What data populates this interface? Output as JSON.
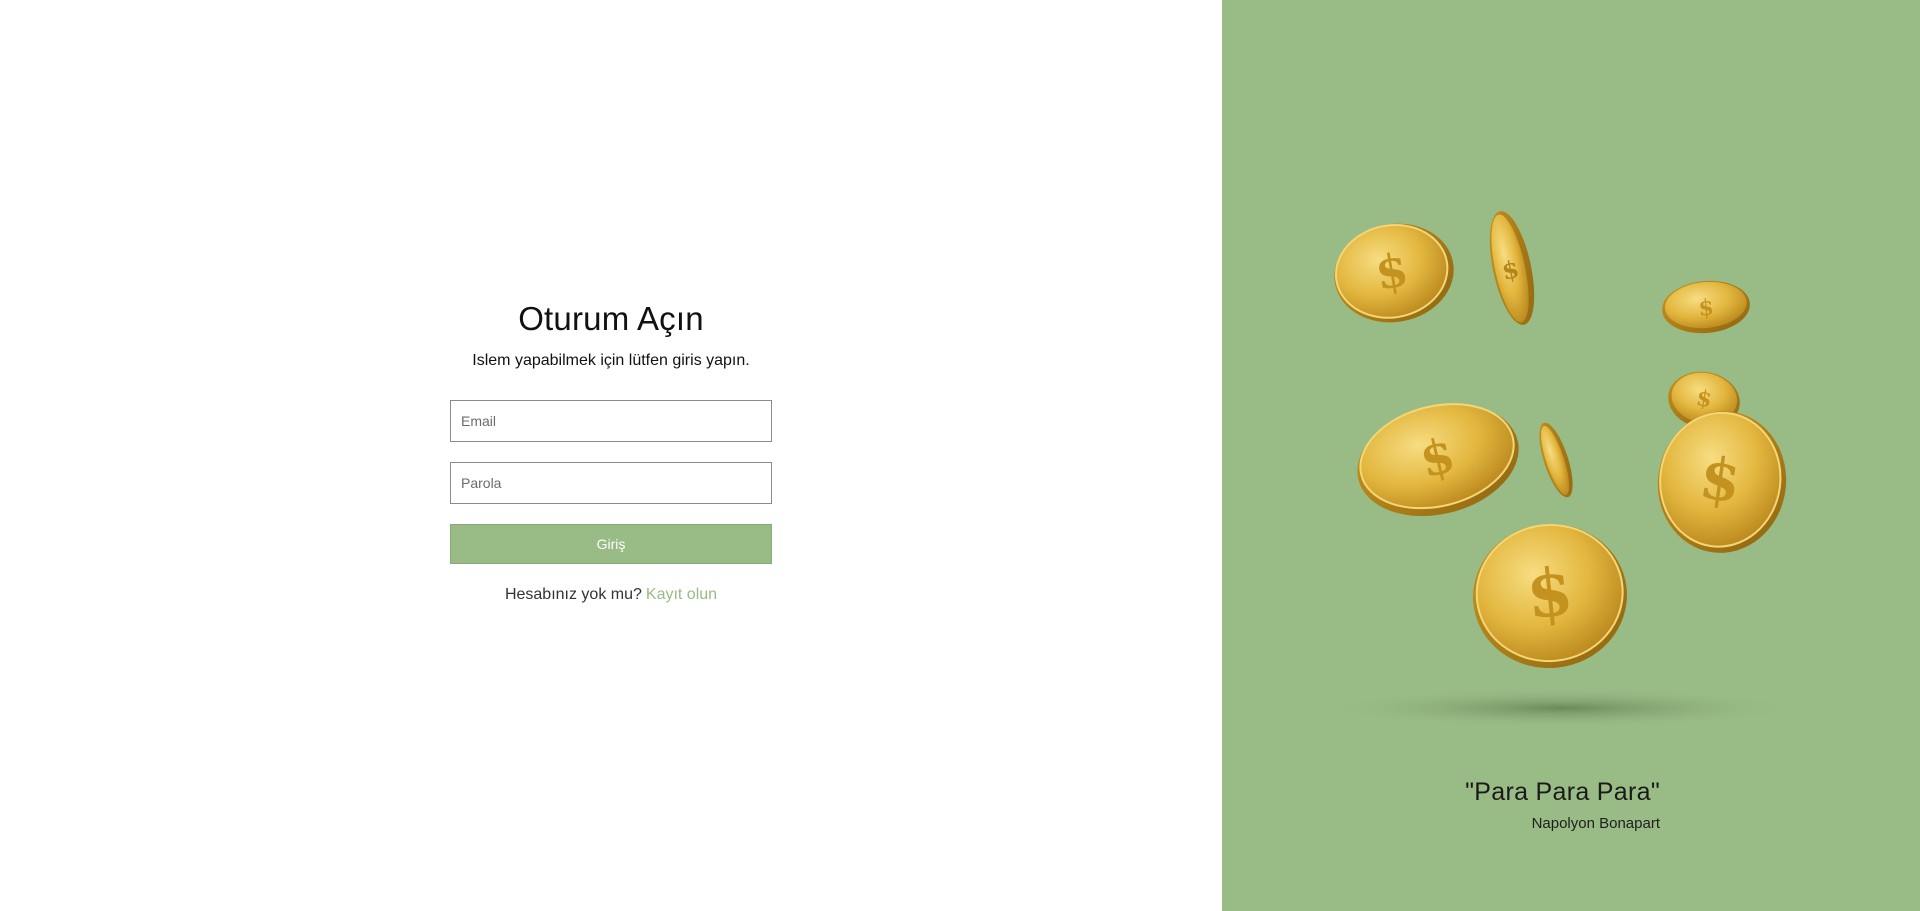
{
  "login": {
    "title": "Oturum Açın",
    "subtitle": "Islem yapabilmek için lütfen giris yapın.",
    "email_placeholder": "Email",
    "password_placeholder": "Parola",
    "submit_label": "Giriş",
    "no_account_text": "Hesabınız yok mu?",
    "signup_link": "Kayıt olun"
  },
  "hero": {
    "quote": "\"Para Para Para\"",
    "author": "Napolyon Bonapart",
    "image_subject": "falling-gold-dollar-coins"
  },
  "colors": {
    "accent": "#99bb85",
    "coin": "#e3b73f",
    "background": "#ffffff"
  }
}
